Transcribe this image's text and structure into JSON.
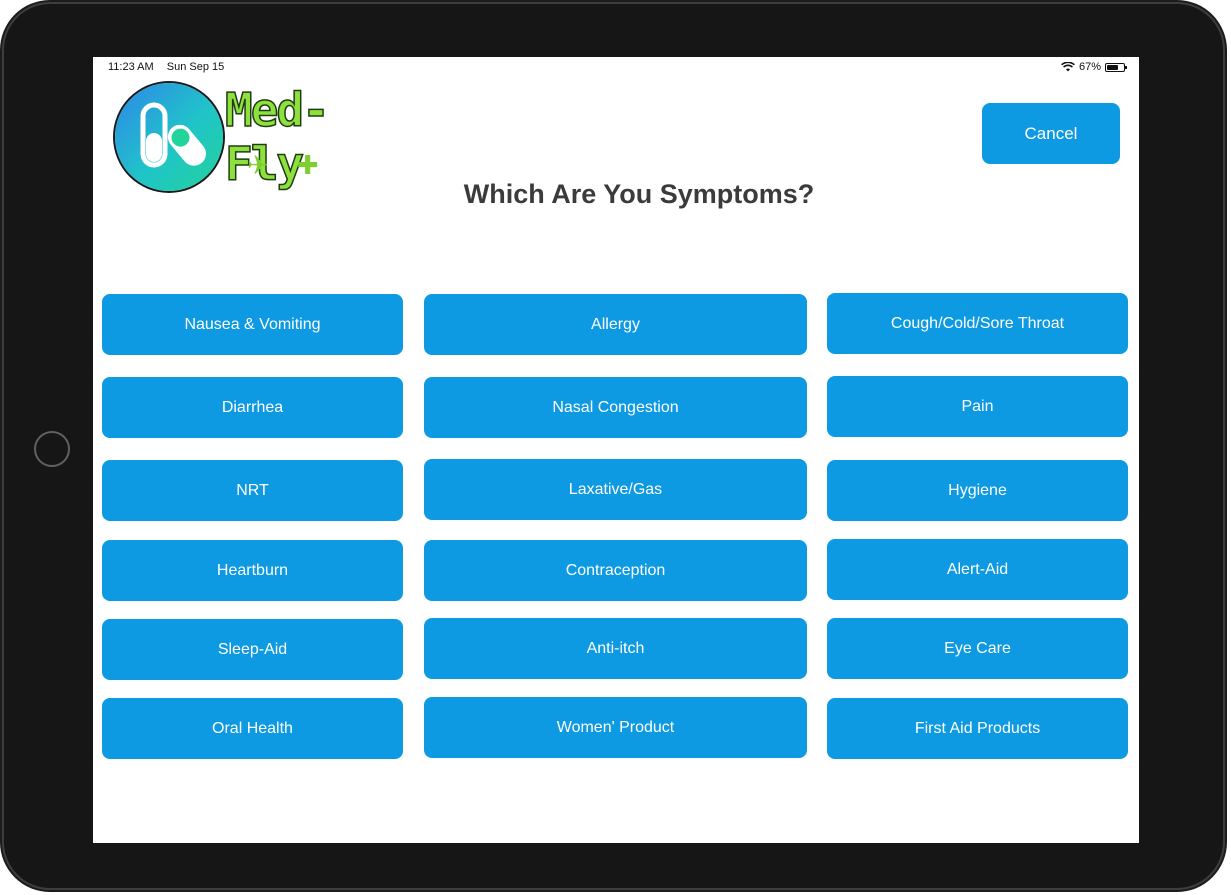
{
  "status_bar": {
    "time": "11:23 AM",
    "date": "Sun Sep 15",
    "battery_text": "67%",
    "battery_level": 0.67,
    "wifi_icon": "wifi-icon"
  },
  "logo": {
    "text": "Med-Fly"
  },
  "header": {
    "cancel_label": "Cancel",
    "title": "Which Are You Symptoms?"
  },
  "colors": {
    "button_blue": "#0d9ae3",
    "title_gray": "#3b3b3b",
    "logo_green": "#8ee03c"
  },
  "symptoms": {
    "col_a": [
      "Nausea & Vomiting",
      "Diarrhea",
      "NRT",
      "Heartburn",
      "Sleep-Aid",
      "Oral Health"
    ],
    "col_b": [
      "Allergy",
      "Nasal Congestion",
      "Laxative/Gas",
      "Contraception",
      "Anti-itch",
      "Women' Product"
    ],
    "col_c": [
      "Cough/Cold/Sore Throat",
      "Pain",
      "Hygiene",
      "Alert-Aid",
      "Eye Care",
      "First Aid Products"
    ]
  }
}
